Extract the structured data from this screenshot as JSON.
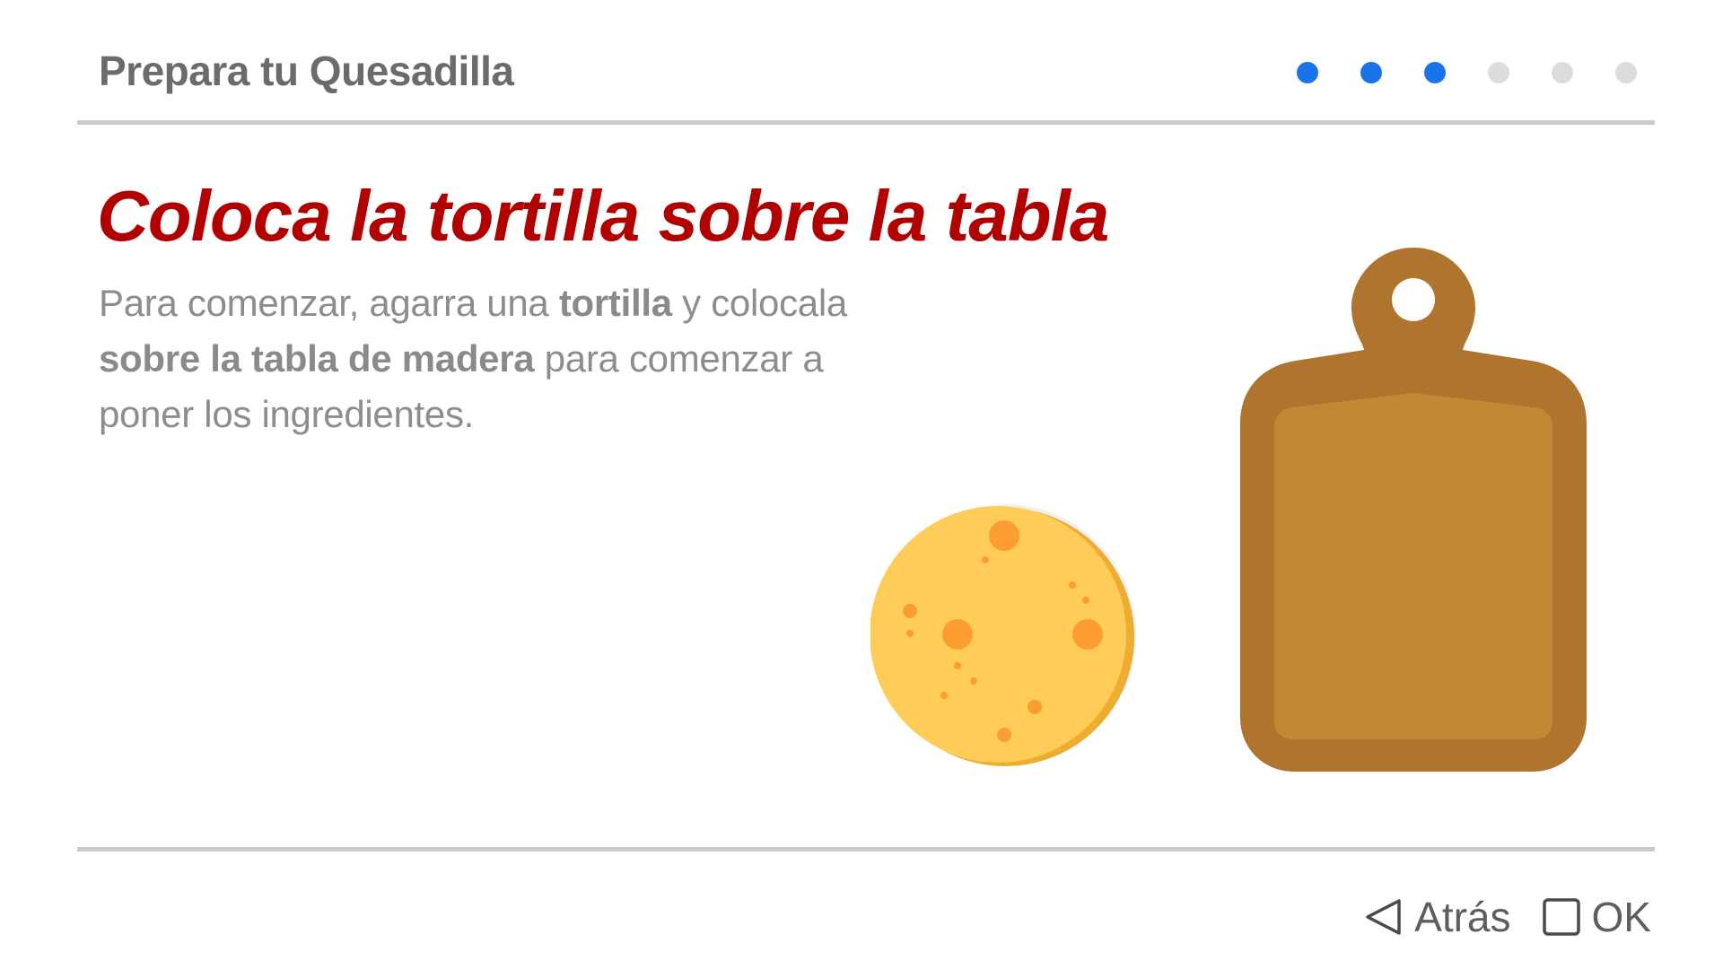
{
  "header": {
    "title": "Prepara tu Quesadilla",
    "progress": {
      "total_steps": 6,
      "current_step": 3,
      "active_color": "#1a73e8",
      "inactive_color": "#dcdcdc"
    }
  },
  "step": {
    "heading": "Coloca la tortilla sobre la tabla",
    "description": {
      "part1": "Para comenzar, agarra una ",
      "bold1": "tortilla",
      "part2": " y colocala ",
      "bold2": "sobre la tabla de madera",
      "part3": " para comenzar a poner los ingredientes."
    },
    "illustrations": [
      "tortilla-icon",
      "cutting-board-icon"
    ]
  },
  "footer": {
    "back_label": "Atrás",
    "back_icon": "triangle-left-icon",
    "ok_label": "OK",
    "ok_icon": "square-icon"
  },
  "colors": {
    "heading": "#b20000",
    "tortilla": "#ffcd57",
    "board": "#af742e"
  }
}
